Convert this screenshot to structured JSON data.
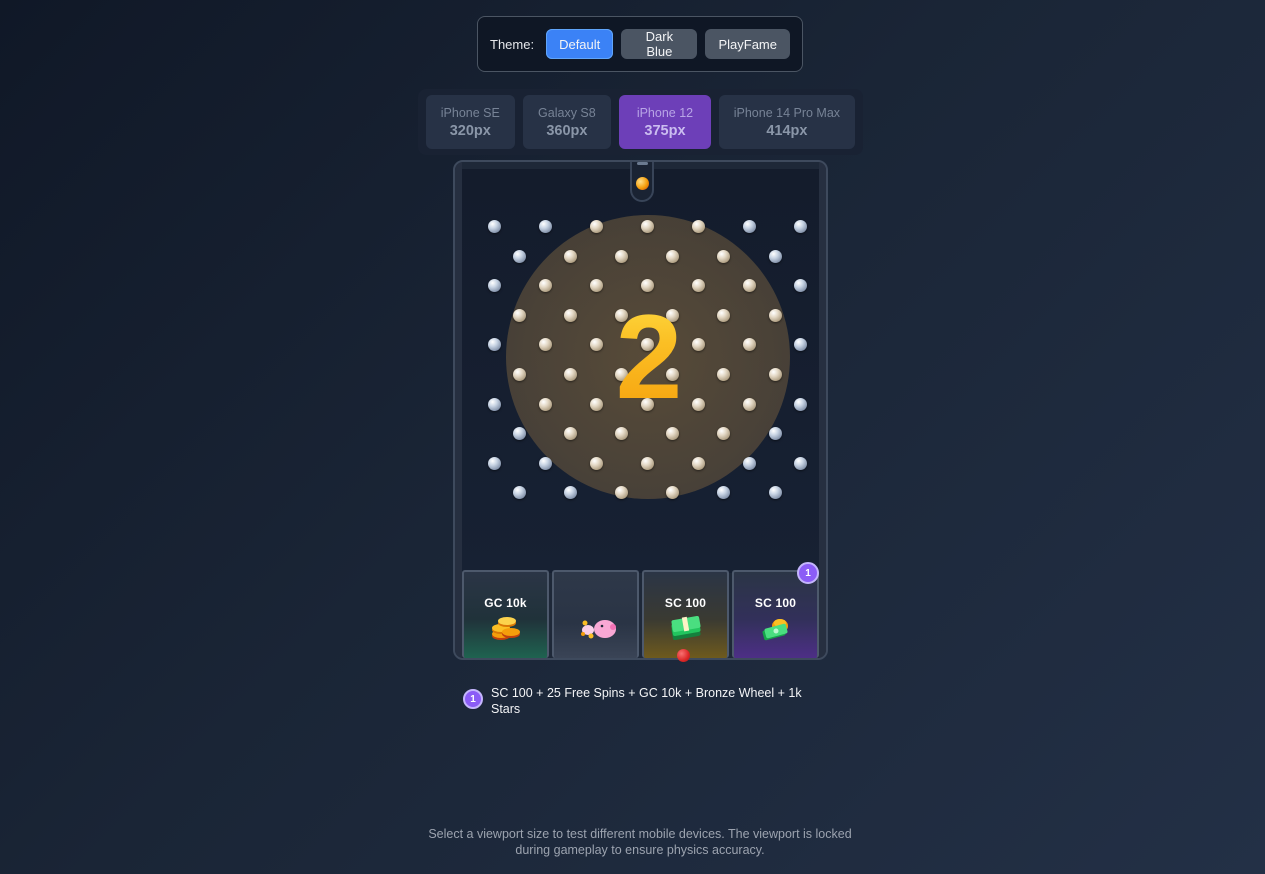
{
  "theme": {
    "label": "Theme:",
    "options": [
      "Default",
      "Dark Blue",
      "PlayFame"
    ],
    "active": "Default",
    "accent": "#3b82f6"
  },
  "devices": [
    {
      "name": "iPhone SE",
      "size": "320px",
      "active": false
    },
    {
      "name": "Galaxy S8",
      "size": "360px",
      "active": false
    },
    {
      "name": "iPhone 12",
      "size": "375px",
      "active": true
    },
    {
      "name": "iPhone 14 Pro Max",
      "size": "414px",
      "active": false
    }
  ],
  "game": {
    "countdown": "2",
    "slots": [
      {
        "label": "GC 10k",
        "icon": "gold-coins-icon",
        "color": "#1f6350"
      },
      {
        "label": "",
        "icon": "piggy-bank-icon",
        "color": "#3a4456"
      },
      {
        "label": "SC 100",
        "icon": "cash-stack-icon",
        "color": "#6e5a1e"
      },
      {
        "label": "SC 100",
        "icon": "cash-bag-icon",
        "color": "#4d2f86",
        "badge": "1"
      }
    ]
  },
  "legend": [
    {
      "badge": "1",
      "text": "SC 100 + 25 Free Spins + GC 10k + Bronze Wheel + 1k Stars"
    }
  ],
  "footer": "Select a viewport size to test different mobile devices. The viewport is locked during gameplay to ensure physics accuracy."
}
